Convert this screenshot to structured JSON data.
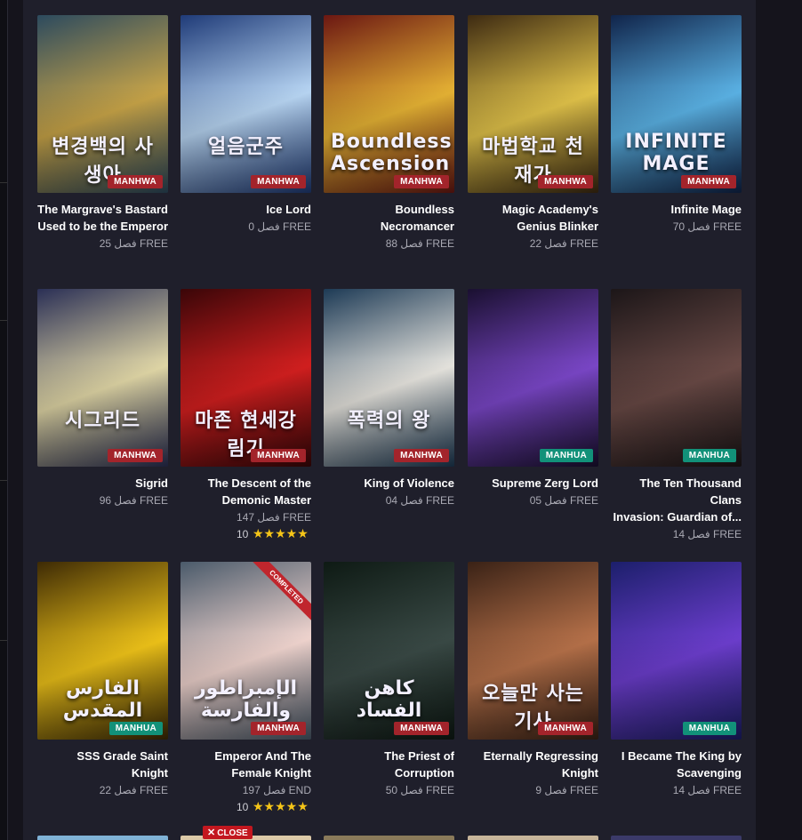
{
  "colors": {
    "manhwa_badge": "#a3242b",
    "manhua_badge": "#129179",
    "panel_bg": "#1f1f2b",
    "star": "#f5c518"
  },
  "close_label": "CLOSE",
  "rows": [
    [
      {
        "title_l1": "The Margrave's Bastard",
        "title_l2": "Used to be the Emperor",
        "chapter": "فصل 25 FREE",
        "type": "MANHWA",
        "cover_text": "변경백의 사생아",
        "colors": [
          "#2c4a5e",
          "#c9a548"
        ]
      },
      {
        "title_l1": "Ice Lord",
        "title_l2": "",
        "chapter": "فصل 0 FREE",
        "type": "MANHWA",
        "cover_text": "얼음군주",
        "colors": [
          "#1f3b78",
          "#b9d7f5"
        ]
      },
      {
        "title_l1": "Boundless Necromancer",
        "title_l2": "",
        "chapter": "فصل 88 FREE",
        "type": "MANHWA",
        "cover_text": "Boundless Ascension",
        "colors": [
          "#6b1712",
          "#e6b334"
        ]
      },
      {
        "title_l1": "Magic Academy's",
        "title_l2": "Genius Blinker",
        "chapter": "فصل 22 FREE",
        "type": "MANHWA",
        "cover_text": "마법학교 천재가",
        "colors": [
          "#3d2a12",
          "#e3c44a"
        ]
      },
      {
        "title_l1": "Infinite Mage",
        "title_l2": "",
        "chapter": "فصل 70 FREE",
        "type": "MANHWA",
        "cover_text": "INFINITE MAGE",
        "colors": [
          "#10244a",
          "#5bb3e6"
        ]
      }
    ],
    [
      {
        "title_l1": "Sigrid",
        "title_l2": "",
        "chapter": "فصل 96 FREE",
        "type": "MANHWA",
        "cover_text": "시그리드",
        "colors": [
          "#2a2f55",
          "#e3d9a8"
        ]
      },
      {
        "title_l1": "The Descent of the",
        "title_l2": "Demonic Master",
        "chapter": "فصل 147 FREE",
        "type": "MANHWA",
        "cover_text": "마존 현세강림기",
        "colors": [
          "#3a0608",
          "#d41f1f"
        ],
        "rating": "10",
        "stars": "★★★★★"
      },
      {
        "title_l1": "King of Violence",
        "title_l2": "",
        "chapter": "فصل 04 FREE",
        "type": "MANHWA",
        "cover_text": "폭력의 왕",
        "colors": [
          "#1d3a55",
          "#e8e6e0"
        ]
      },
      {
        "title_l1": "Supreme Zerg Lord",
        "title_l2": "",
        "chapter": "فصل 05 FREE",
        "type": "MANHUA",
        "cover_text": "",
        "colors": [
          "#1a1030",
          "#7b47c9"
        ]
      },
      {
        "title_l1": "The Ten Thousand Clans",
        "title_l2": "Invasion: Guardian of...",
        "chapter": "فصل 14 FREE",
        "type": "MANHUA",
        "cover_text": "",
        "colors": [
          "#1c1618",
          "#6a4a46"
        ]
      }
    ],
    [
      {
        "title_l1": "SSS Grade Saint Knight",
        "title_l2": "",
        "chapter": "فصل 22 FREE",
        "type": "MANHUA",
        "cover_text": "الفارس المقدس",
        "colors": [
          "#3d2a05",
          "#f0c419"
        ]
      },
      {
        "title_l1": "Emperor And The",
        "title_l2": "Female Knight",
        "chapter": "فصل 197 END",
        "type": "MANHWA",
        "cover_text": "الإمبراطور والفارسة",
        "colors": [
          "#4a5a6a",
          "#f2d6d0"
        ],
        "rating": "10",
        "stars": "★★★★★",
        "ribbon": "COMPLETED"
      },
      {
        "title_l1": "The Priest of Corruption",
        "title_l2": "",
        "chapter": "فصل 50 FREE",
        "type": "MANHWA",
        "cover_text": "كاهن الفساد",
        "colors": [
          "#0e1a14",
          "#3a4a46"
        ]
      },
      {
        "title_l1": "Eternally Regressing",
        "title_l2": "Knight",
        "chapter": "فصل 9 FREE",
        "type": "MANHWA",
        "cover_text": "오늘만 사는 기사",
        "colors": [
          "#3a2216",
          "#b8724a"
        ]
      },
      {
        "title_l1": "I Became The King by",
        "title_l2": "Scavenging",
        "chapter": "فصل 14 FREE",
        "type": "MANHUA",
        "cover_text": "",
        "colors": [
          "#1c1f6b",
          "#6d3ecf"
        ]
      }
    ]
  ]
}
